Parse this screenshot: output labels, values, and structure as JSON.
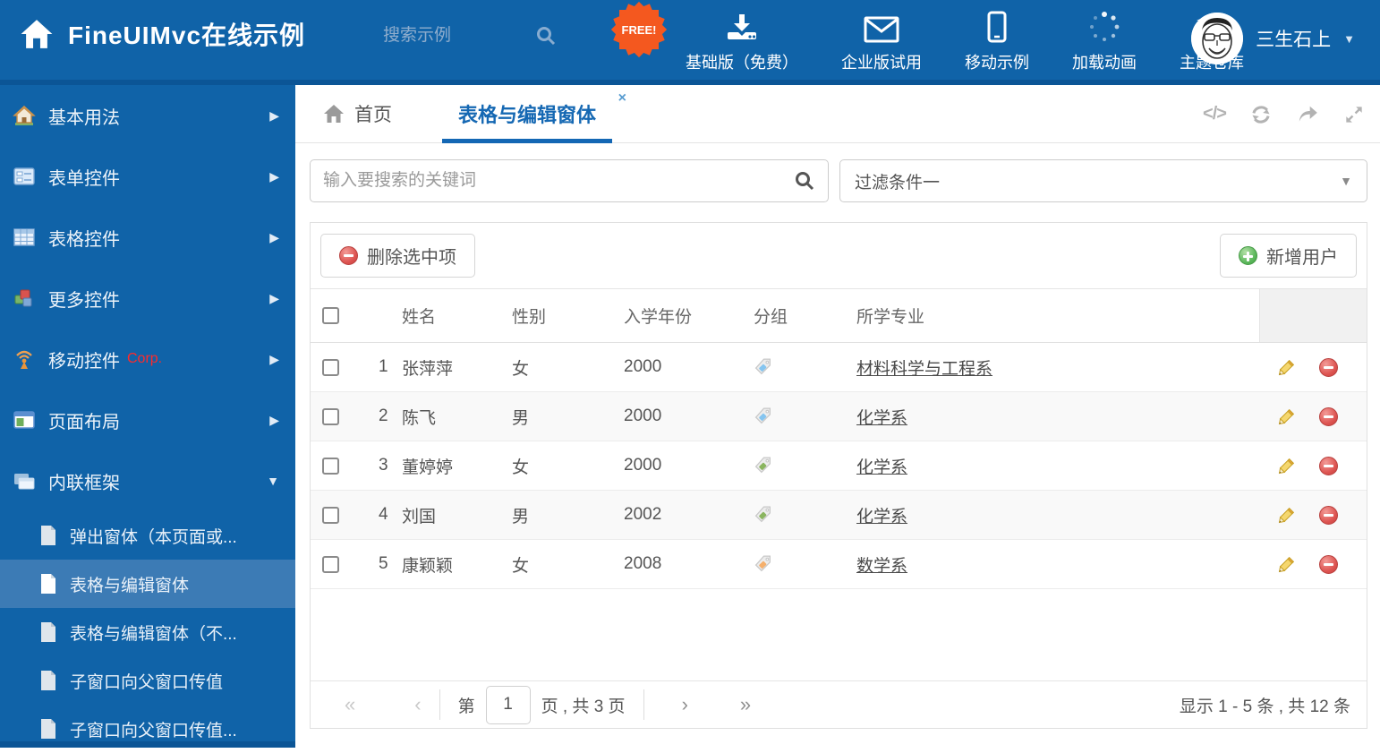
{
  "header": {
    "title": "FineUIMvc在线示例",
    "search_placeholder": "搜索示例",
    "free_badge": "FREE!",
    "nav": [
      {
        "label": "基础版（免费）",
        "icon": "download-icon"
      },
      {
        "label": "企业版试用",
        "icon": "envelope-icon"
      },
      {
        "label": "移动示例",
        "icon": "mobile-icon"
      },
      {
        "label": "加载动画",
        "icon": "spinner-icon"
      },
      {
        "label": "主题仓库",
        "icon": "bank-icon"
      }
    ],
    "user": {
      "name": "三生石上"
    }
  },
  "sidebar": {
    "items": [
      {
        "label": "基本用法"
      },
      {
        "label": "表单控件"
      },
      {
        "label": "表格控件"
      },
      {
        "label": "更多控件"
      },
      {
        "label": "移动控件",
        "badge": "Corp."
      },
      {
        "label": "页面布局"
      },
      {
        "label": "内联框架",
        "expanded": true
      }
    ],
    "subitems": [
      {
        "label": "弹出窗体（本页面或..."
      },
      {
        "label": "表格与编辑窗体",
        "active": true
      },
      {
        "label": "表格与编辑窗体（不..."
      },
      {
        "label": "子窗口向父窗口传值"
      },
      {
        "label": "子窗口向父窗口传值..."
      }
    ]
  },
  "tabs": {
    "home": "首页",
    "active": "表格与编辑窗体"
  },
  "filters": {
    "search_placeholder": "输入要搜索的关键词",
    "filter_selected": "过滤条件一"
  },
  "grid": {
    "delete_button": "删除选中项",
    "add_button": "新增用户",
    "columns": {
      "name": "姓名",
      "gender": "性别",
      "year": "入学年份",
      "group": "分组",
      "major": "所学专业"
    },
    "rows": [
      {
        "index": "1",
        "name": "张萍萍",
        "gender": "女",
        "year": "2000",
        "tag_color": "#85c5f0",
        "major": "材料科学与工程系"
      },
      {
        "index": "2",
        "name": "陈飞",
        "gender": "男",
        "year": "2000",
        "tag_color": "#85c5f0",
        "major": "化学系"
      },
      {
        "index": "3",
        "name": "董婷婷",
        "gender": "女",
        "year": "2000",
        "tag_color": "#8ab55f",
        "major": "化学系"
      },
      {
        "index": "4",
        "name": "刘国",
        "gender": "男",
        "year": "2002",
        "tag_color": "#8ab55f",
        "major": "化学系"
      },
      {
        "index": "5",
        "name": "康颖颖",
        "gender": "女",
        "year": "2008",
        "tag_color": "#f5b06c",
        "major": "数学系"
      }
    ]
  },
  "pagination": {
    "label_page": "第",
    "page_value": "1",
    "label_total": "页 , 共 3 页",
    "first": "«",
    "prev": "‹",
    "next": "›",
    "last": "»",
    "summary": "显示 1 - 5 条 , 共 12 条"
  },
  "icons": {
    "code": "</>",
    "caret_down": "▼",
    "chevron_right": "▶",
    "close": "×"
  },
  "colors": {
    "header_blue": "#1063a8",
    "header_dark": "#0b5596",
    "selected_item": "#3c7bb5",
    "active_tab": "#1568b3",
    "free_badge": "#f4581f",
    "delete_red": "#d9534f",
    "add_green": "#5cb85c"
  }
}
